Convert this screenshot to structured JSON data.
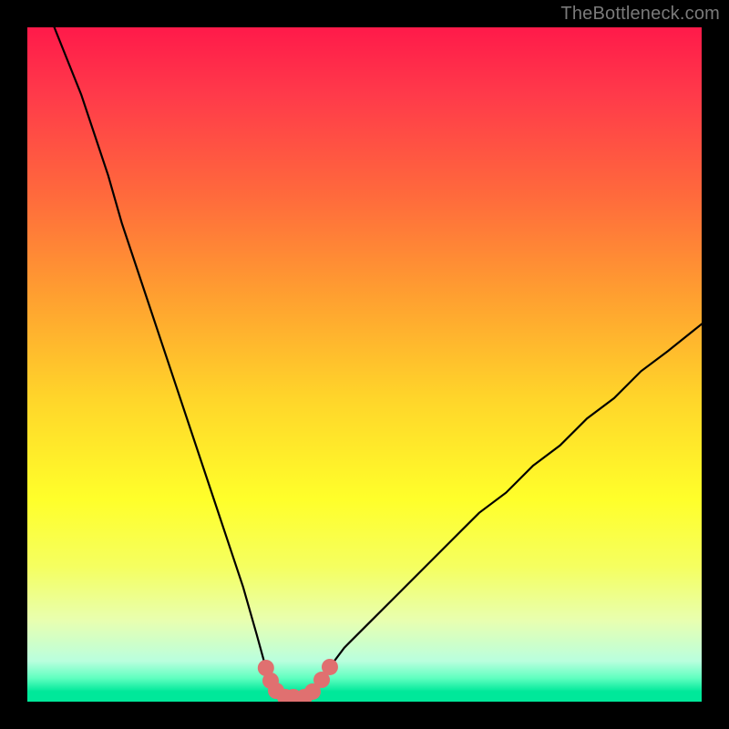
{
  "attribution": "TheBottleneck.com",
  "colors": {
    "frame": "#000000",
    "attribution": "#7a7a7a",
    "curve": "#000000",
    "markers": "#e07070",
    "gradient_stops": [
      {
        "offset": 0.0,
        "color": "#ff1a4a"
      },
      {
        "offset": 0.1,
        "color": "#ff3a4a"
      },
      {
        "offset": 0.25,
        "color": "#ff6a3c"
      },
      {
        "offset": 0.4,
        "color": "#ffa030"
      },
      {
        "offset": 0.55,
        "color": "#ffd52a"
      },
      {
        "offset": 0.7,
        "color": "#ffff2a"
      },
      {
        "offset": 0.8,
        "color": "#f5ff60"
      },
      {
        "offset": 0.88,
        "color": "#e8ffb0"
      },
      {
        "offset": 0.94,
        "color": "#b9ffde"
      },
      {
        "offset": 0.965,
        "color": "#60ffc0"
      },
      {
        "offset": 0.985,
        "color": "#00e89a"
      },
      {
        "offset": 1.0,
        "color": "#00e89a"
      }
    ]
  },
  "chart_data": {
    "type": "line",
    "title": "",
    "xlabel": "",
    "ylabel": "",
    "xlim": [
      0,
      100
    ],
    "ylim": [
      0,
      100
    ],
    "grid": false,
    "legend": null,
    "series": [
      {
        "name": "bottleneck-curve",
        "x": [
          4,
          6,
          8,
          10,
          12,
          14,
          16,
          18,
          20,
          22,
          24,
          26,
          28,
          30,
          32,
          34,
          35.38,
          36.08,
          36.89,
          38.24,
          39.46,
          41.08,
          42.3,
          43.65,
          44.86,
          47,
          51,
          55,
          59,
          63,
          67,
          71,
          75,
          79,
          83,
          87,
          91,
          95,
          100
        ],
        "values": [
          100,
          95,
          90,
          84,
          78,
          71,
          65,
          59,
          53,
          47,
          41,
          35,
          29,
          23,
          17,
          10,
          5.0,
          3.11,
          1.62,
          0.68,
          0.68,
          0.68,
          1.49,
          3.24,
          5.14,
          8,
          12,
          16,
          20,
          24,
          28,
          31,
          35,
          38,
          42,
          45,
          49,
          52,
          56
        ]
      }
    ],
    "markers": {
      "name": "highlighted-points",
      "x": [
        35.38,
        36.08,
        36.89,
        38.24,
        39.46,
        41.08,
        42.3,
        43.65,
        44.86
      ],
      "values": [
        5.0,
        3.11,
        1.62,
        0.68,
        0.68,
        0.68,
        1.49,
        3.24,
        5.14
      ]
    }
  }
}
